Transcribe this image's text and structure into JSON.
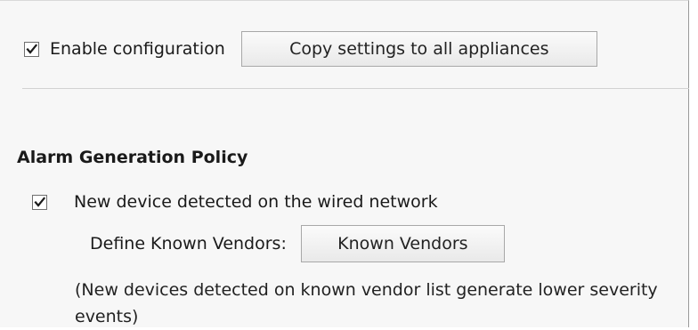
{
  "config": {
    "enable_label": "Enable configuration",
    "enable_checked": true,
    "copy_button_label": "Copy settings to all appliances"
  },
  "alarm": {
    "heading": "Alarm Generation Policy",
    "new_device_label": "New device detected on the wired network",
    "new_device_checked": true,
    "vendors_label": "Define Known Vendors:",
    "vendors_button_label": "Known Vendors",
    "note": "(New devices detected on known vendor list generate lower severity events)"
  },
  "colors": {
    "panel_bg": "#f7f7f7",
    "check_mark": "#1a1a1a"
  }
}
